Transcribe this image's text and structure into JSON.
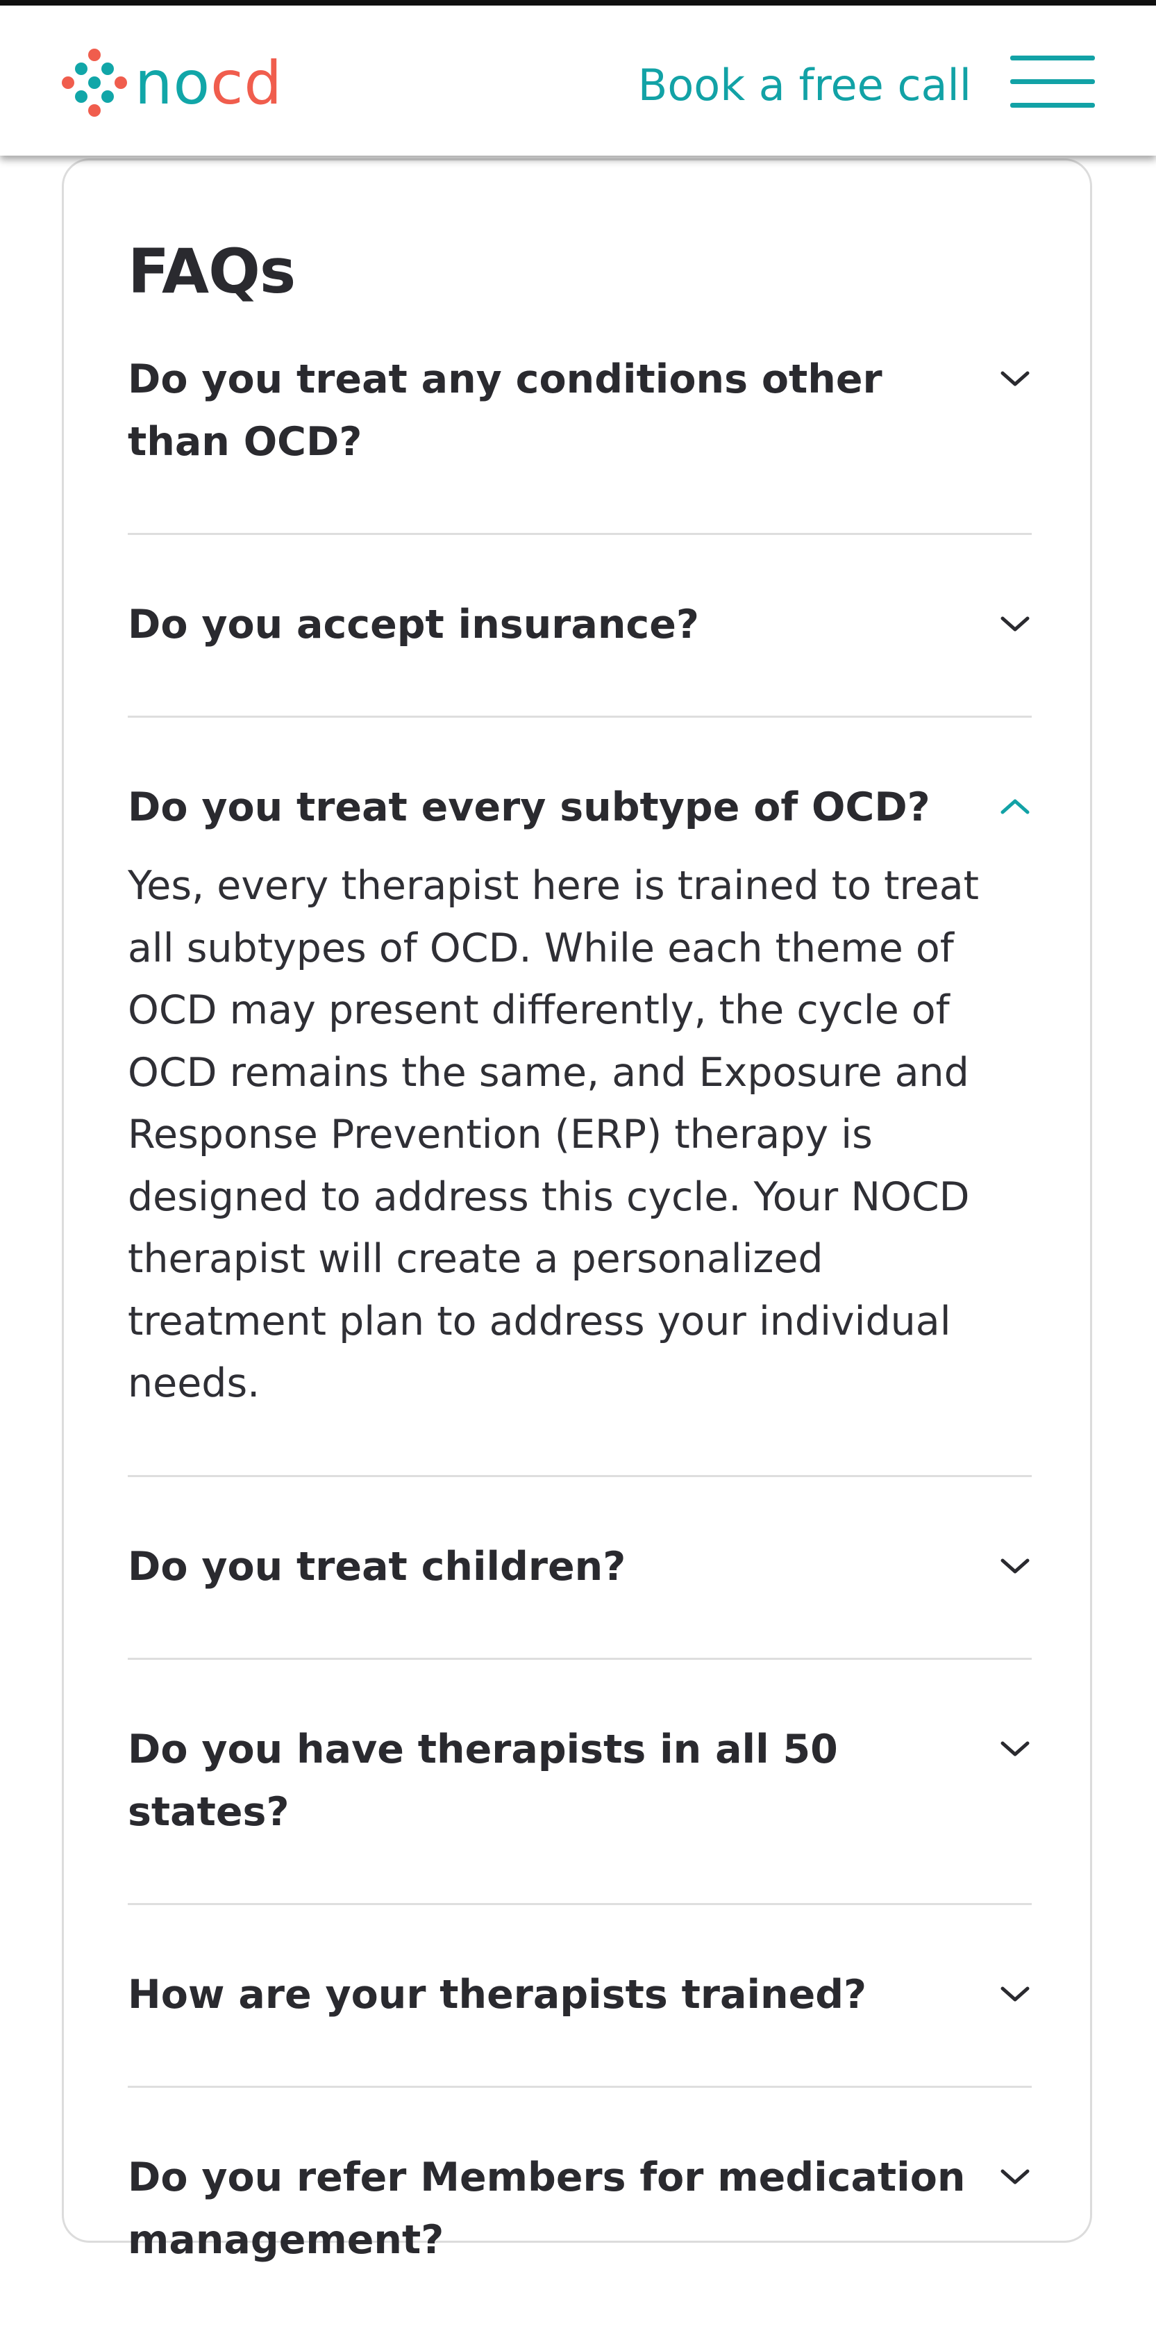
{
  "header": {
    "logo_text_part1": "no",
    "logo_text_part2": "cd",
    "book_link": "Book a free call",
    "menu_icon": "hamburger-menu-icon",
    "colors": {
      "teal": "#12a2a6",
      "coral": "#f05d4d"
    }
  },
  "faq": {
    "title": "FAQs",
    "items": [
      {
        "question": "Do you treat any conditions other than OCD?",
        "expanded": false,
        "icon": "chevron-down-icon"
      },
      {
        "question": "Do you accept insurance?",
        "expanded": false,
        "icon": "chevron-down-icon"
      },
      {
        "question": "Do you treat every subtype of OCD?",
        "expanded": true,
        "icon": "chevron-up-icon",
        "answer": "Yes, every therapist here is trained to treat all subtypes of OCD. While each theme of OCD may present differently, the cycle of OCD remains the same, and Exposure and Response Prevention (ERP) therapy is designed to address this cycle. Your NOCD therapist will create a personalized treatment plan to address your individual needs."
      },
      {
        "question": "Do you treat children?",
        "expanded": false,
        "icon": "chevron-down-icon"
      },
      {
        "question": "Do you have therapists in all 50 states?",
        "expanded": false,
        "icon": "chevron-down-icon"
      },
      {
        "question": "How are your therapists trained?",
        "expanded": false,
        "icon": "chevron-down-icon"
      },
      {
        "question": "Do you refer Members for medication management?",
        "expanded": false,
        "icon": "chevron-down-icon"
      }
    ]
  }
}
